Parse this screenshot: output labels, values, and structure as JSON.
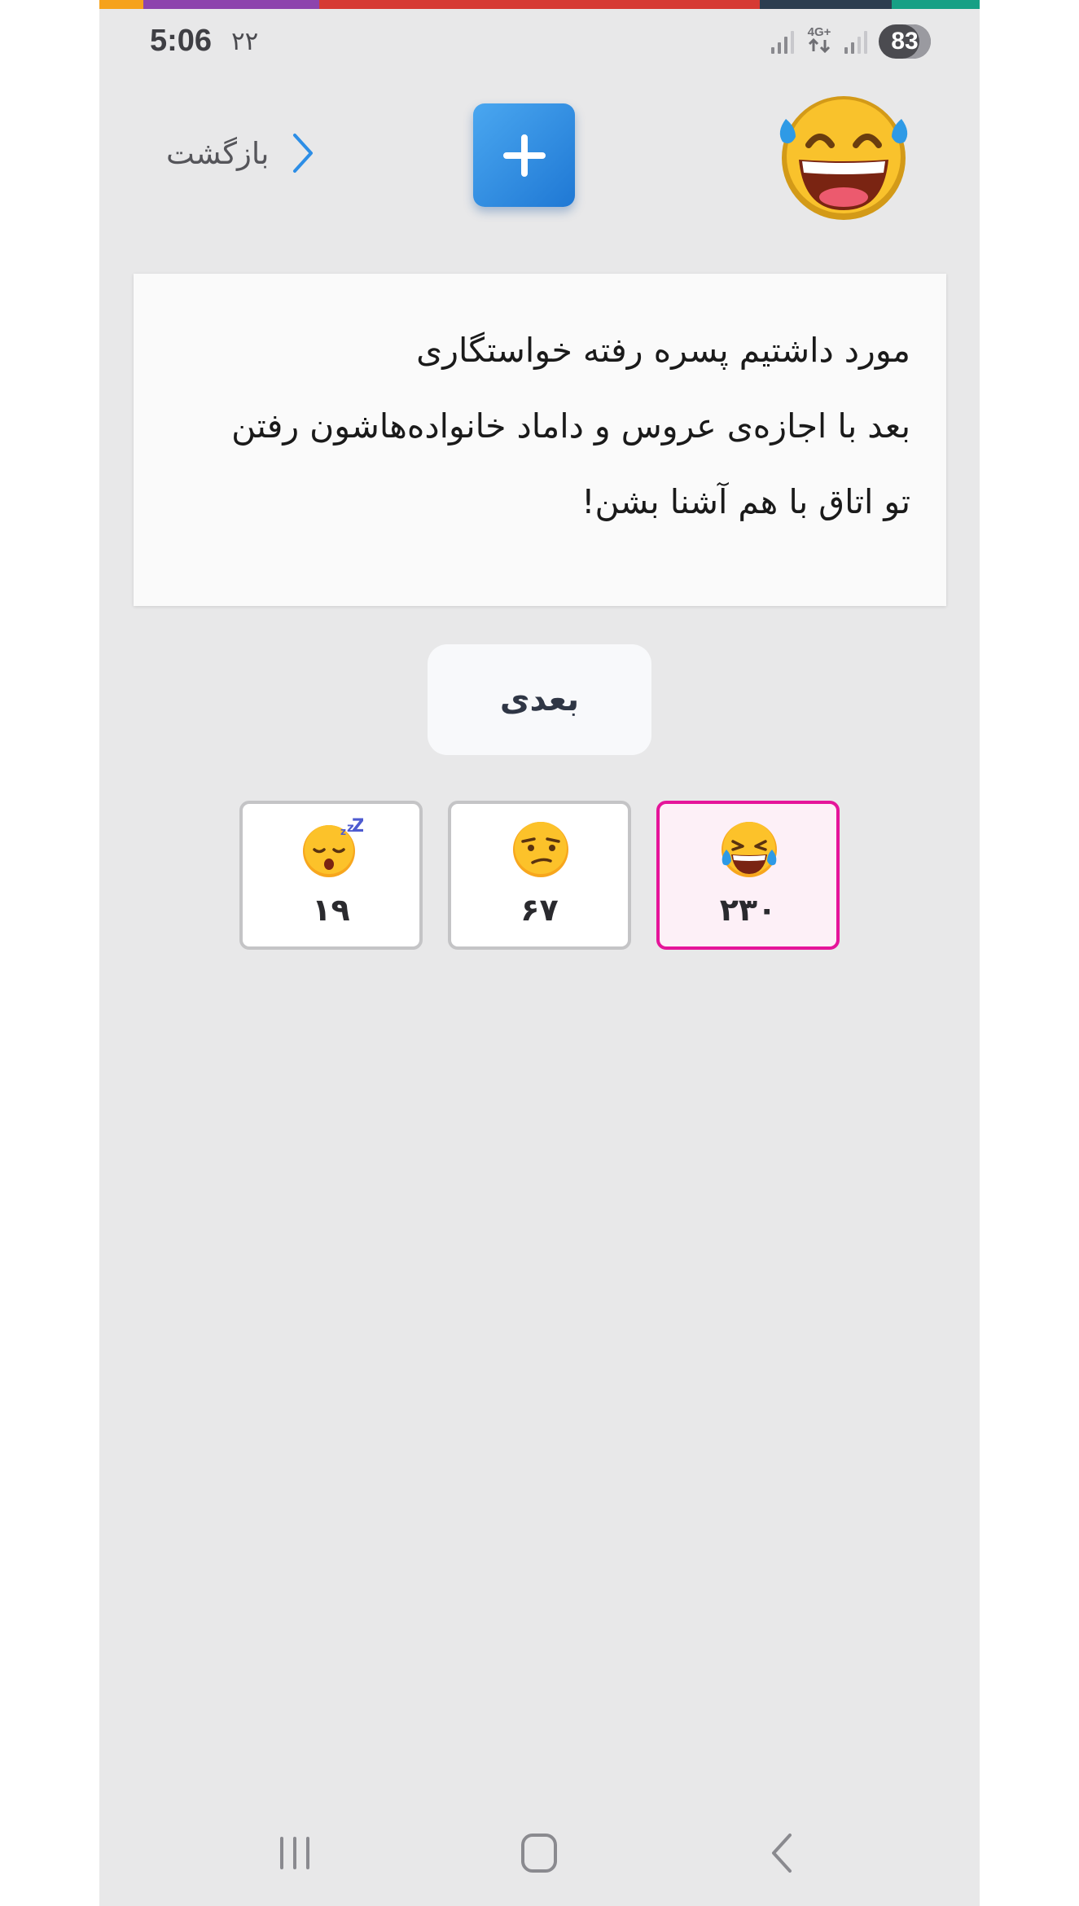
{
  "status_bar": {
    "time": "5:06",
    "date": "۲۲",
    "network": "4G+",
    "battery": "83"
  },
  "header": {
    "back_label": "بازگشت",
    "add_label": "+"
  },
  "joke": {
    "lines": [
      "مورد داشتیم پسره رفته خواستگاری",
      "بعد با اجازه‌ی عروس و داماد خانواده‌هاشون رفتن",
      "تو اتاق با هم آشنا بشن!"
    ]
  },
  "next_button": {
    "label": "بعدی"
  },
  "reactions": [
    {
      "icon": "sleepy-face-icon",
      "count": "۱۹",
      "selected": false
    },
    {
      "icon": "unamused-face-icon",
      "count": "۶۷",
      "selected": false
    },
    {
      "icon": "laughing-tears-face-icon",
      "count": "۲۳۰",
      "selected": true
    }
  ],
  "colors": {
    "accent_blue": "#2d8ee6",
    "selected_pink": "#e5159a",
    "background": "#e8e8e9",
    "strip": [
      "#f6a21b",
      "#8d44ad",
      "#d63a34",
      "#2c3e50",
      "#16a085"
    ]
  }
}
